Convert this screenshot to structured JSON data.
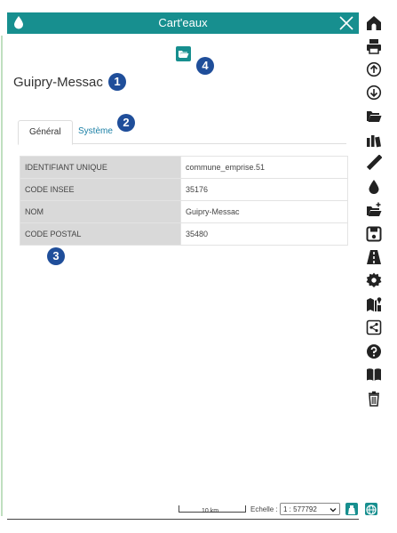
{
  "panel": {
    "title": "Cart'eaux",
    "place_name": "Guipry-Messac",
    "tabs": [
      {
        "label": "Général",
        "active": true
      },
      {
        "label": "Système",
        "active": false
      }
    ],
    "attributes": [
      {
        "key": "IDENTIFIANT UNIQUE",
        "value": "commune_emprise.51"
      },
      {
        "key": "CODE INSEE",
        "value": "35176"
      },
      {
        "key": "NOM",
        "value": "Guipry-Messac"
      },
      {
        "key": "CODE POSTAL",
        "value": "35480"
      }
    ]
  },
  "annotations": [
    "1",
    "2",
    "3",
    "4"
  ],
  "footer": {
    "scale_bar_label": "10 km",
    "scale_label": "Echelle :",
    "scale_value": "1 : 577792"
  },
  "colors": {
    "accent": "#178f8f",
    "badge": "#1f4e9a",
    "toolbar_icon": "#222222",
    "link": "#1a7fa5"
  },
  "toolbar_icons": [
    "home-icon",
    "print-icon",
    "upload-icon",
    "download-icon",
    "folder-open-icon",
    "layers-catalog-icon",
    "ruler-icon",
    "water-drop-icon",
    "folder-add-icon",
    "save-icon",
    "road-icon",
    "settings-icon",
    "map-info-icon",
    "share-icon",
    "help-icon",
    "book-icon",
    "trash-icon"
  ],
  "icons": {
    "header_left": "water-drop-icon",
    "close": "close-icon",
    "export": "folder-export-icon",
    "footer_1": "flask-icon",
    "footer_2": "globe-icon"
  }
}
